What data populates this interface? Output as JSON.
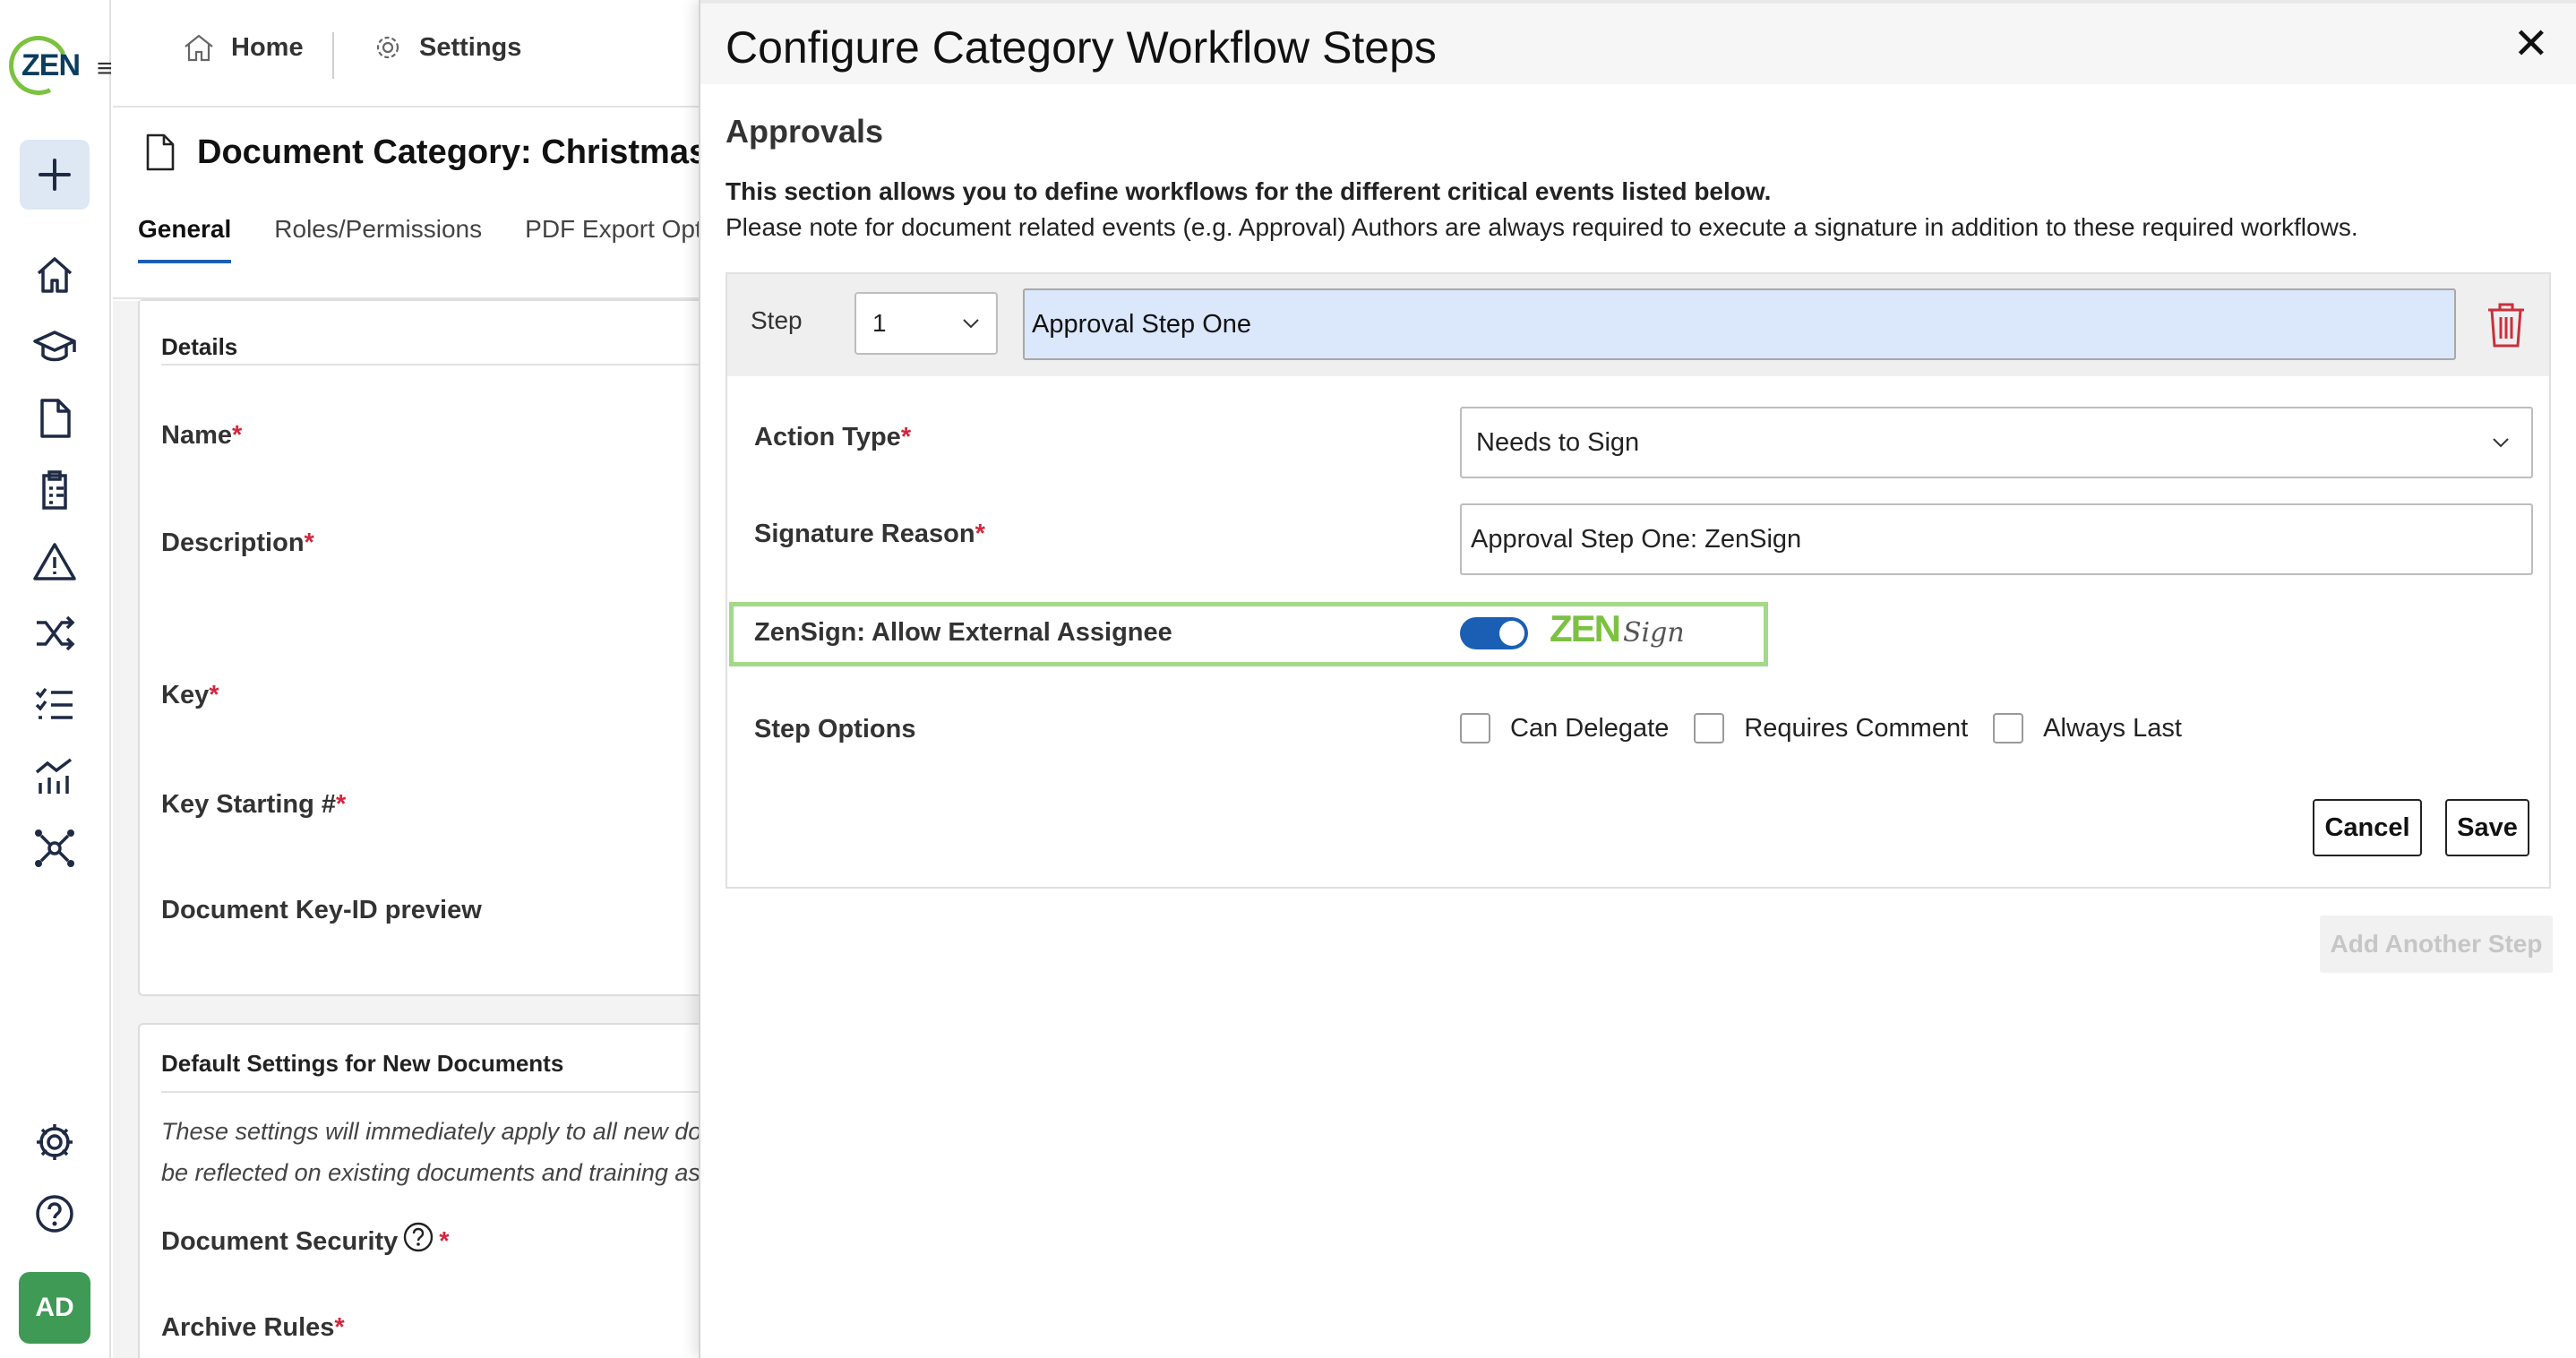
{
  "app": {
    "logo_text": "ZEN",
    "avatar_initials": "AD"
  },
  "rail": {
    "icons": [
      "hamburger-menu-icon",
      "plus-icon",
      "home-icon",
      "graduation-cap-icon",
      "document-icon",
      "clipboard-icon",
      "warning-icon",
      "shuffle-icon",
      "checklist-icon",
      "analytics-icon",
      "network-icon",
      "gear-icon",
      "help-icon"
    ]
  },
  "topbar": {
    "home_label": "Home",
    "settings_label": "Settings"
  },
  "page": {
    "title": "Document Category: Christmas Co",
    "tabs": [
      "General",
      "Roles/Permissions",
      "PDF Export Opti"
    ]
  },
  "details_card": {
    "heading": "Details",
    "fields": [
      "Name",
      "Description",
      "Key",
      "Key Starting #",
      "Document Key-ID preview"
    ]
  },
  "defaults_card": {
    "heading": "Default Settings for New Documents",
    "text_line1": "These settings will immediately apply to all new docur",
    "text_line2": "be reflected on existing documents and training assigr",
    "field_security": "Document Security",
    "field_archive": "Archive Rules"
  },
  "modal": {
    "title": "Configure Category Workflow Steps",
    "section_title": "Approvals",
    "desc_bold": "This section allows you to define workflows for the different critical events listed below.",
    "desc_normal": "Please note for document related events (e.g. Approval) Authors are always required to execute a signature in addition to these required workflows.",
    "step": {
      "label": "Step",
      "number": "1",
      "name": "Approval Step One",
      "action_type_label": "Action Type",
      "action_type_value": "Needs to Sign",
      "signature_reason_label": "Signature Reason",
      "signature_reason_value": "Approval Step One: ZenSign",
      "external_assignee_label": "ZenSign: Allow External Assignee",
      "external_assignee_enabled": true,
      "zensign_brand": "ZEN",
      "zensign_brand_script": "Sign",
      "step_options_label": "Step Options",
      "options": [
        {
          "label": "Can Delegate",
          "checked": false
        },
        {
          "label": "Requires Comment",
          "checked": false
        },
        {
          "label": "Always Last",
          "checked": false
        }
      ],
      "cancel_label": "Cancel",
      "save_label": "Save"
    },
    "add_step_label": "Add Another Step"
  },
  "colors": {
    "accent": "#1a5fb4",
    "brand_green": "#7cc241",
    "required": "#d3263d",
    "delete": "#c9303c",
    "highlight": "#a3d98a"
  }
}
